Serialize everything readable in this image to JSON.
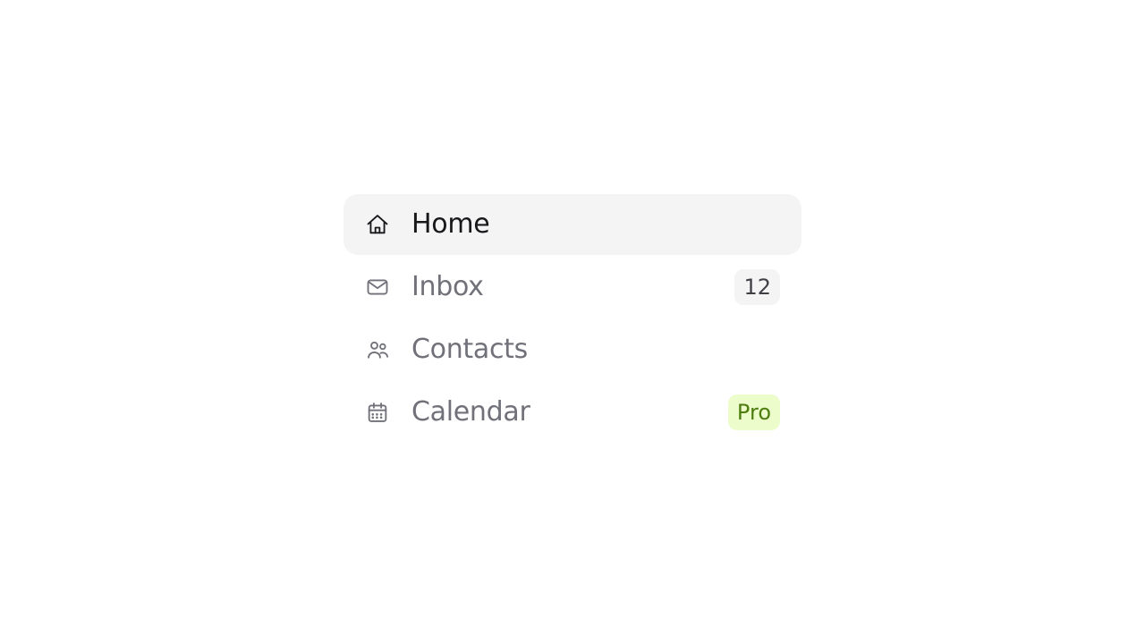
{
  "nav": {
    "items": [
      {
        "label": "Home",
        "active": true
      },
      {
        "label": "Inbox",
        "active": false,
        "badge": "12",
        "badge_kind": "count"
      },
      {
        "label": "Contacts",
        "active": false
      },
      {
        "label": "Calendar",
        "active": false,
        "badge": "Pro",
        "badge_kind": "pro"
      }
    ]
  }
}
